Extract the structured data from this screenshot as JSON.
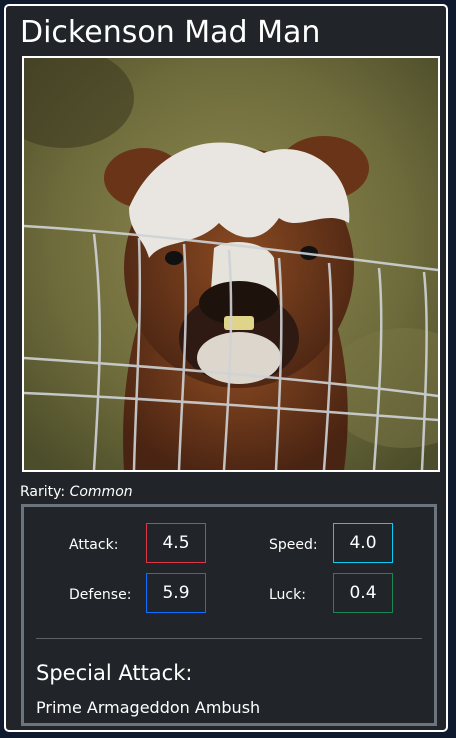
{
  "card": {
    "name": "Dickenson Mad Man",
    "image_alt": "alpaca behind wire fence",
    "rarity_label": "Rarity:",
    "rarity_value": "Common"
  },
  "stats": {
    "attack": {
      "label": "Attack:",
      "value": "4.5",
      "color": "#dc3545"
    },
    "speed": {
      "label": "Speed:",
      "value": "4.0",
      "color": "#0dcaf0"
    },
    "defense": {
      "label": "Defense:",
      "value": "5.9",
      "color": "#0d6efd"
    },
    "luck": {
      "label": "Luck:",
      "value": "0.4",
      "color": "#198754"
    }
  },
  "special_attack": {
    "title": "Special Attack:",
    "name": "Prime Armageddon Ambush"
  },
  "colors": {
    "card_bg": "#212529",
    "border": "#ffffff",
    "stats_border": "#6c757d"
  }
}
